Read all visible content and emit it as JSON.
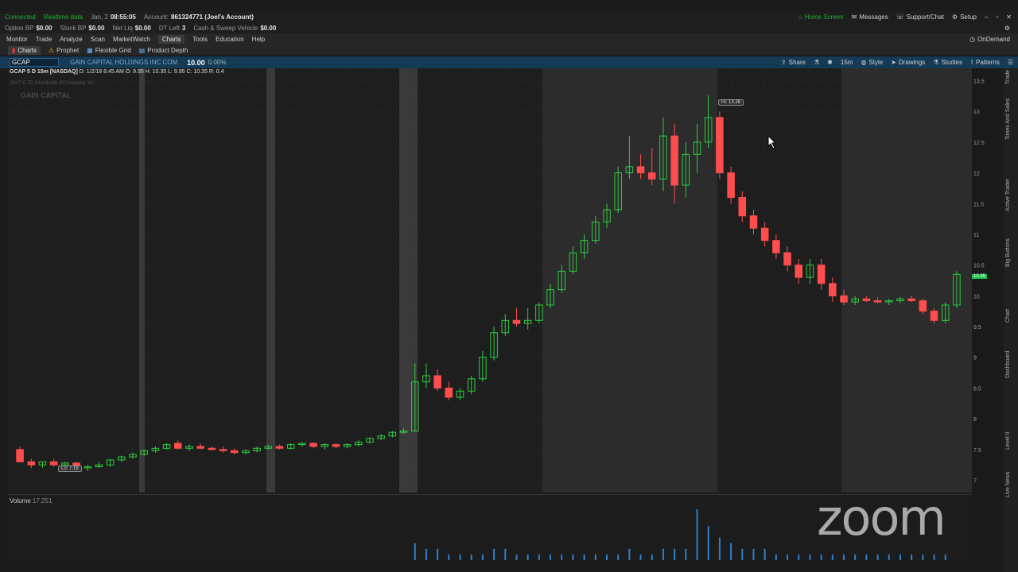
{
  "status": {
    "connection": "Connected",
    "data_mode": "Realtime data",
    "date": "Jan, 2",
    "time": "08:55:05",
    "account_label": "Account:",
    "account_value": "861324771 (Joel's Account)"
  },
  "topright": {
    "home": "Home Screen",
    "messages": "Messages",
    "support": "Support/Chat",
    "setup": "Setup"
  },
  "balances": [
    {
      "label": "Option BP",
      "value": "$0.00"
    },
    {
      "label": "Stock BP",
      "value": "$0.00"
    },
    {
      "label": "Net Liq",
      "value": "$0.00"
    },
    {
      "label": "DT Left",
      "value": "3"
    },
    {
      "label": "Cash & Sweep Vehicle",
      "value": "$0.00"
    }
  ],
  "menu": [
    "Monitor",
    "Trade",
    "Analyze",
    "Scan",
    "MarketWatch",
    "Charts",
    "Tools",
    "Education",
    "Help"
  ],
  "menu_active": "Charts",
  "ondemand": "OnDemand",
  "subtabs": [
    "Charts",
    "Prophet",
    "Flexible Grid",
    "Product Depth"
  ],
  "symbol": {
    "ticker": "GCAP",
    "company": "GAIN CAPITAL HOLDINGS INC COM",
    "price": "10.00",
    "change": "0.00%"
  },
  "chart_toolbar": [
    "Share",
    "15m",
    "Style",
    "Drawings",
    "Studies",
    "Patterns"
  ],
  "chart": {
    "title": "GCAP 5 D 15m [NASDAQ]",
    "ohlc": "D: 1/2/18 8:45 AM  O: 9.95  H: 10.35  L: 9.95  C: 10.35  R: 0.4",
    "watermark": "2017 © TD Ameritrade IP Company, Inc.",
    "watermark_brand": "GAIN CAPITAL",
    "hi_tag": "Hi: 13.26",
    "lo_tag": "Lo: 7.15",
    "last_flag": "10.35"
  },
  "volume": {
    "label": "Volume",
    "value": "17,251"
  },
  "side_tabs": [
    "Trade",
    "Times And Sales",
    "Active Trader",
    "Big Buttons",
    "Chart",
    "Dashboard",
    "Level II",
    "Live News"
  ],
  "zoom_watermark": "zoom",
  "chart_data": {
    "type": "candlestick",
    "ylim": [
      6.8,
      13.7
    ],
    "y_ticks": [
      "13.5",
      "13",
      "12.5",
      "12",
      "11.5",
      "11",
      "10.5",
      "10",
      "9.5",
      "9",
      "8.5",
      "8",
      "7.5",
      "7"
    ],
    "bars": [
      [
        7.5,
        7.55,
        7.3,
        7.3
      ],
      [
        7.3,
        7.35,
        7.2,
        7.25
      ],
      [
        7.25,
        7.3,
        7.2,
        7.3
      ],
      [
        7.3,
        7.35,
        7.22,
        7.25
      ],
      [
        7.25,
        7.3,
        7.2,
        7.28
      ],
      [
        7.28,
        7.3,
        7.15,
        7.2
      ],
      [
        7.2,
        7.25,
        7.15,
        7.22
      ],
      [
        7.22,
        7.3,
        7.2,
        7.25
      ],
      [
        7.25,
        7.35,
        7.22,
        7.33
      ],
      [
        7.33,
        7.4,
        7.3,
        7.38
      ],
      [
        7.38,
        7.45,
        7.35,
        7.42
      ],
      [
        7.42,
        7.5,
        7.4,
        7.48
      ],
      [
        7.48,
        7.55,
        7.45,
        7.52
      ],
      [
        7.52,
        7.6,
        7.5,
        7.58
      ],
      [
        7.6,
        7.65,
        7.5,
        7.52
      ],
      [
        7.52,
        7.58,
        7.48,
        7.55
      ],
      [
        7.55,
        7.6,
        7.5,
        7.52
      ],
      [
        7.52,
        7.55,
        7.48,
        7.5
      ],
      [
        7.5,
        7.55,
        7.45,
        7.48
      ],
      [
        7.48,
        7.52,
        7.42,
        7.45
      ],
      [
        7.45,
        7.5,
        7.42,
        7.48
      ],
      [
        7.48,
        7.55,
        7.45,
        7.52
      ],
      [
        7.52,
        7.58,
        7.5,
        7.55
      ],
      [
        7.55,
        7.58,
        7.5,
        7.52
      ],
      [
        7.52,
        7.6,
        7.5,
        7.58
      ],
      [
        7.58,
        7.62,
        7.55,
        7.6
      ],
      [
        7.6,
        7.62,
        7.52,
        7.55
      ],
      [
        7.55,
        7.6,
        7.5,
        7.58
      ],
      [
        7.58,
        7.6,
        7.52,
        7.55
      ],
      [
        7.55,
        7.6,
        7.52,
        7.58
      ],
      [
        7.58,
        7.65,
        7.55,
        7.62
      ],
      [
        7.62,
        7.7,
        7.6,
        7.68
      ],
      [
        7.68,
        7.75,
        7.65,
        7.72
      ],
      [
        7.72,
        7.8,
        7.7,
        7.78
      ],
      [
        7.78,
        7.85,
        7.75,
        7.8
      ],
      [
        7.8,
        8.9,
        7.8,
        8.6
      ],
      [
        8.6,
        8.9,
        8.5,
        8.7
      ],
      [
        8.7,
        8.8,
        8.45,
        8.5
      ],
      [
        8.5,
        8.6,
        8.3,
        8.35
      ],
      [
        8.35,
        8.5,
        8.3,
        8.45
      ],
      [
        8.45,
        8.7,
        8.4,
        8.65
      ],
      [
        8.65,
        9.1,
        8.6,
        9.0
      ],
      [
        9.0,
        9.5,
        8.95,
        9.4
      ],
      [
        9.4,
        9.7,
        9.35,
        9.6
      ],
      [
        9.6,
        9.8,
        9.5,
        9.55
      ],
      [
        9.55,
        9.8,
        9.45,
        9.6
      ],
      [
        9.6,
        9.9,
        9.55,
        9.85
      ],
      [
        9.85,
        10.2,
        9.8,
        10.1
      ],
      [
        10.1,
        10.5,
        10.05,
        10.4
      ],
      [
        10.4,
        10.8,
        10.35,
        10.7
      ],
      [
        10.7,
        11.0,
        10.6,
        10.9
      ],
      [
        10.9,
        11.3,
        10.85,
        11.2
      ],
      [
        11.2,
        11.5,
        11.1,
        11.4
      ],
      [
        11.4,
        12.1,
        11.35,
        12.0
      ],
      [
        12.0,
        12.6,
        11.9,
        12.1
      ],
      [
        12.1,
        12.3,
        11.9,
        12.0
      ],
      [
        12.0,
        12.4,
        11.8,
        11.9
      ],
      [
        11.9,
        12.9,
        11.7,
        12.6
      ],
      [
        12.6,
        12.8,
        11.5,
        11.8
      ],
      [
        11.8,
        12.5,
        11.6,
        12.3
      ],
      [
        12.3,
        12.8,
        12.0,
        12.5
      ],
      [
        12.5,
        13.26,
        12.4,
        12.9
      ],
      [
        12.9,
        13.0,
        11.9,
        12.0
      ],
      [
        12.0,
        12.1,
        11.5,
        11.6
      ],
      [
        11.6,
        11.7,
        11.2,
        11.3
      ],
      [
        11.3,
        11.4,
        11.0,
        11.1
      ],
      [
        11.1,
        11.2,
        10.8,
        10.9
      ],
      [
        10.9,
        11.0,
        10.6,
        10.7
      ],
      [
        10.7,
        10.8,
        10.4,
        10.5
      ],
      [
        10.5,
        10.6,
        10.2,
        10.3
      ],
      [
        10.3,
        10.6,
        10.2,
        10.5
      ],
      [
        10.5,
        10.6,
        10.1,
        10.2
      ],
      [
        10.2,
        10.3,
        9.9,
        10.0
      ],
      [
        10.0,
        10.1,
        9.85,
        9.9
      ],
      [
        9.9,
        10.0,
        9.85,
        9.95
      ],
      [
        9.95,
        10.0,
        9.9,
        9.92
      ],
      [
        9.92,
        9.98,
        9.88,
        9.9
      ],
      [
        9.9,
        9.95,
        9.85,
        9.92
      ],
      [
        9.92,
        9.98,
        9.88,
        9.95
      ],
      [
        9.95,
        10.0,
        9.9,
        9.92
      ],
      [
        9.92,
        9.95,
        9.7,
        9.75
      ],
      [
        9.75,
        9.8,
        9.55,
        9.6
      ],
      [
        9.6,
        9.9,
        9.55,
        9.85
      ],
      [
        9.85,
        10.4,
        9.8,
        10.35
      ]
    ],
    "volume": [
      0,
      0,
      0,
      0,
      0,
      0,
      0,
      0,
      0,
      0,
      0,
      0,
      0,
      0,
      0,
      0,
      0,
      0,
      0,
      0,
      0,
      0,
      0,
      0,
      0,
      0,
      0,
      0,
      0,
      0,
      0,
      0,
      0,
      0,
      0,
      3,
      2,
      2,
      1,
      1,
      1,
      1,
      2,
      2,
      1,
      1,
      1,
      1,
      1,
      1,
      1,
      1,
      1,
      1,
      2,
      1,
      1,
      2,
      2,
      2,
      9,
      6,
      4,
      3,
      2,
      2,
      2,
      1,
      1,
      1,
      1,
      1,
      1,
      1,
      1,
      1,
      1,
      1,
      1,
      1,
      1,
      1,
      1
    ]
  }
}
